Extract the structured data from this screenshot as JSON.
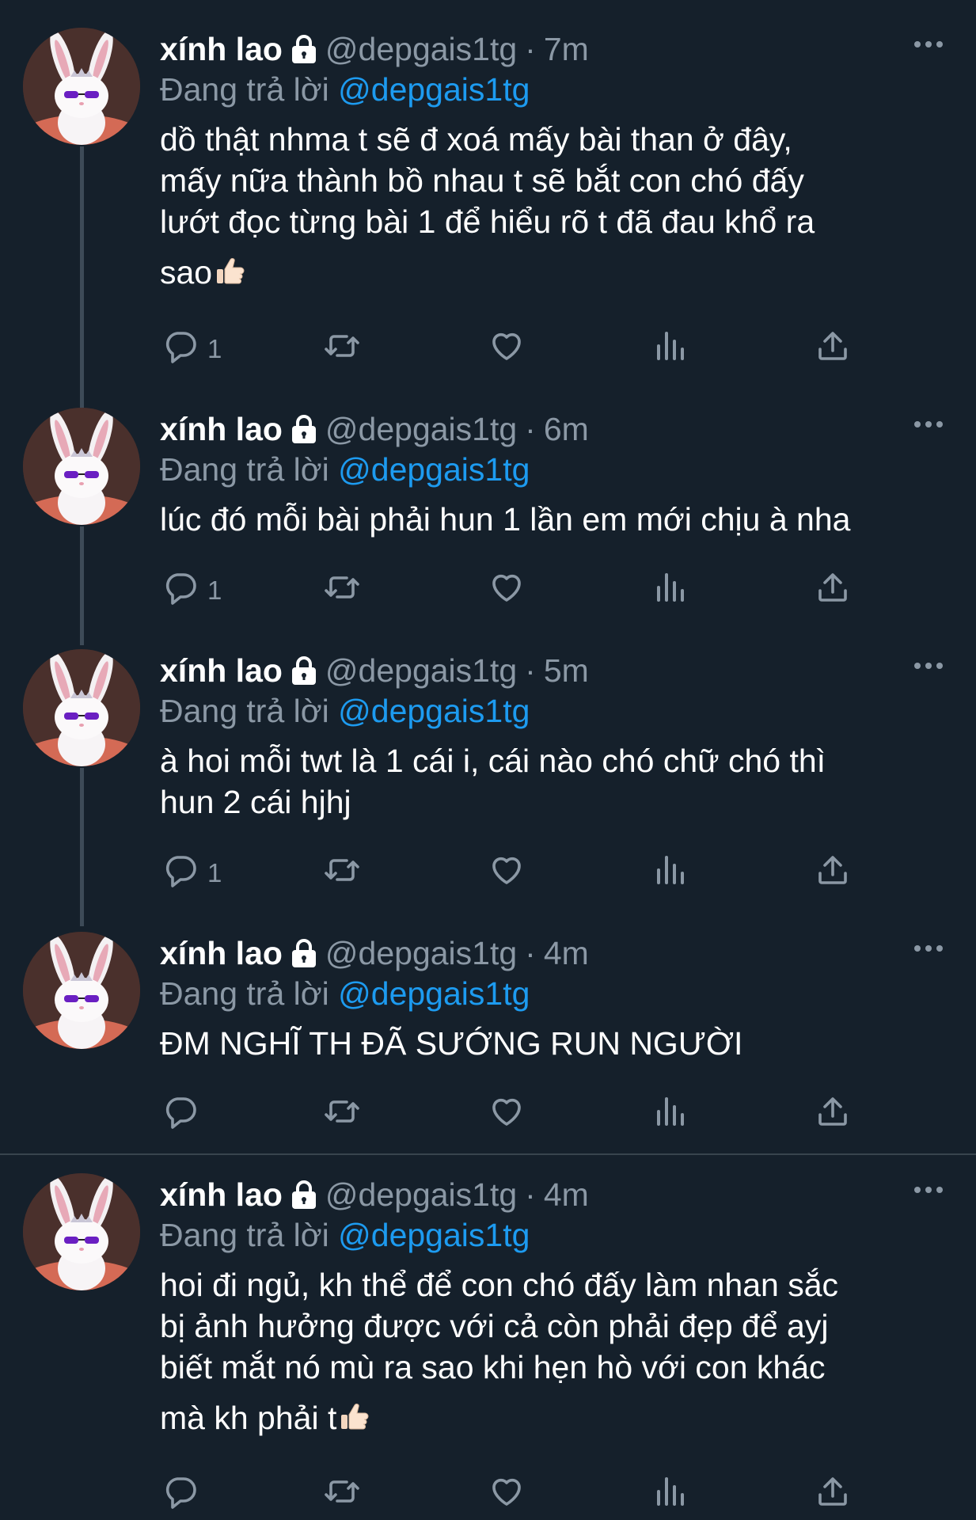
{
  "user": {
    "name": "xính lao",
    "handle": "@depgais1tg",
    "replying_prefix": "Đang trả lời",
    "replying_to": "@depgais1tg"
  },
  "tweets": [
    {
      "time": "7m",
      "lines": [
        "dồ thật nhma t sẽ đ xoá mấy bài than ở đây,",
        "mấy nữa thành bồ nhau t sẽ bắt con chó đấy",
        "lướt đọc từng bài 1 để hiểu rõ t đã đau khổ ra",
        "sao"
      ],
      "trailing_emoji": "thumbs-up-emoji",
      "reply_count": "1"
    },
    {
      "time": "6m",
      "lines": [
        "lúc đó mỗi bài phải hun 1 lần em mới chịu à nha"
      ],
      "reply_count": "1"
    },
    {
      "time": "5m",
      "lines": [
        "à hoi mỗi twt là 1 cái i, cái nào chó chữ chó thì",
        "hun 2 cái hjhj"
      ],
      "reply_count": "1"
    },
    {
      "time": "4m",
      "lines": [
        "ĐM NGHĨ TH ĐÃ SƯỚNG RUN NGƯỜI"
      ],
      "reply_count": ""
    },
    {
      "time": "4m",
      "lines": [
        "hoi đi ngủ, kh thể để con chó đấy làm nhan sắc",
        "bị ảnh hưởng được với cả còn phải đẹp để ayj",
        "biết mắt nó mù ra sao khi hẹn hò với con khác",
        "mà kh phải t"
      ],
      "trailing_emoji": "thumbs-up-emoji",
      "reply_count": ""
    }
  ],
  "colors": {
    "background": "#15202b",
    "text_primary": "#ffffff",
    "text_secondary": "#8b98a5",
    "link": "#1d9bf0",
    "thread_line": "#3d4a57"
  },
  "icons": [
    "lock-icon",
    "more-icon",
    "reply-icon",
    "retweet-icon",
    "like-icon",
    "views-icon",
    "share-icon"
  ]
}
